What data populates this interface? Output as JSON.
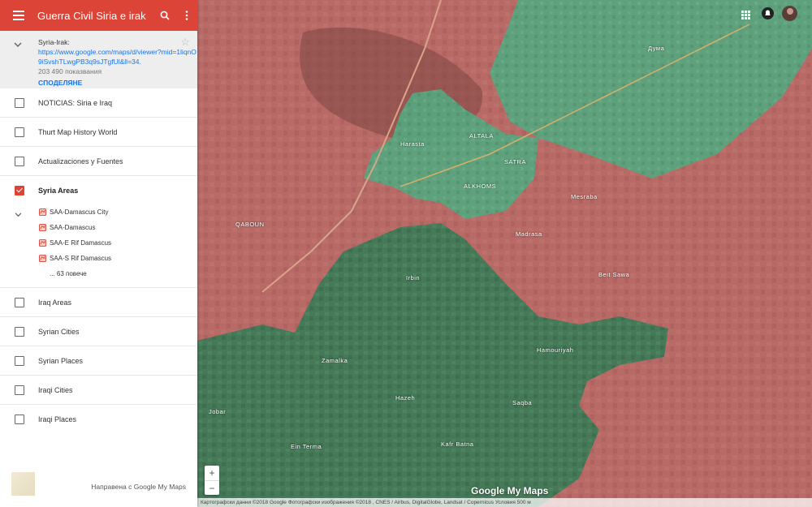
{
  "header": {
    "title": "Guerra Civil Siria e irak"
  },
  "map_info": {
    "name": "Syria-Irak:",
    "url": "https://www.google.com/maps/d/viewer?mid=1liqnO9iSvshTLwgPB3q9sJTgfUl&ll=34.",
    "views": "203 490 показвания",
    "share_label": "СПОДЕЛЯНЕ"
  },
  "layers": [
    {
      "label": "NOTICIAS: Siria e Iraq",
      "checked": false
    },
    {
      "label": "Thurt Map History World",
      "checked": false
    },
    {
      "label": "Actualizaciones y Fuentes",
      "checked": false
    }
  ],
  "active_layer": {
    "label": "Syria Areas",
    "checked": true,
    "items": [
      "SAA-Damascus City",
      "SAA-Damascus",
      "SAA-E Rif Damascus",
      "SAA-S Rif Damascus"
    ],
    "more": "... 63 повече"
  },
  "layers_after": [
    {
      "label": "Iraq Areas",
      "checked": false
    },
    {
      "label": "Syrian Cities",
      "checked": false
    },
    {
      "label": "Syrian Places",
      "checked": false
    },
    {
      "label": "Iraqi Cities",
      "checked": false
    },
    {
      "label": "Iraqi Places",
      "checked": false
    }
  ],
  "footer": {
    "made_with": "Направена с Google My Maps"
  },
  "map": {
    "zoom_in": "+",
    "zoom_out": "−",
    "attribution": "Картографски данни ©2018 Google Фотографски изображения ©2018 , CNES / Airbus, DigitalGlobe, Landsat / Copernicus   Условия   500 м",
    "logo": "Google My Maps",
    "labels": [
      "Думa",
      "Harasta",
      "ALTALA",
      "SATRA",
      "ALKHOMS",
      "Mesraba",
      "Madrasa",
      "Beit Sawa",
      "QABOUN",
      "Irbin",
      "Zamalka",
      "Hamouriyah",
      "Kafr Batna",
      "Jobar",
      "Ein Terma",
      "Saqba",
      "Hazeh"
    ],
    "colors": {
      "red": "#b86a66",
      "green_east": "#4f9e75",
      "green_south": "#3f7a57",
      "accent": "#db4437"
    }
  }
}
